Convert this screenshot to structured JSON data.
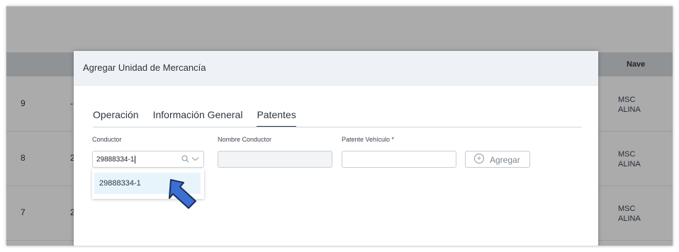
{
  "background_table": {
    "header": {
      "nave_label": "Nave"
    },
    "rows": [
      {
        "id_fragment": "9",
        "second_fragment": "-",
        "nave_line1": "MSC",
        "nave_line2": "ALINA"
      },
      {
        "id_fragment": "8",
        "second_fragment": "2",
        "nave_line1": "MSC",
        "nave_line2": "ALINA"
      },
      {
        "id_fragment": "7",
        "second_fragment": "2",
        "nave_line1": "MSC",
        "nave_line2": "ALINA"
      }
    ]
  },
  "modal": {
    "title": "Agregar Unidad de Mercancía",
    "tabs": [
      {
        "label": "Operación",
        "active": false
      },
      {
        "label": "Información General",
        "active": false
      },
      {
        "label": "Patentes",
        "active": true
      }
    ],
    "fields": {
      "conductor": {
        "label": "Conductor",
        "value": "29888334-1"
      },
      "nombre_conductor": {
        "label": "Nombre Conductor",
        "value": ""
      },
      "patente_vehiculo": {
        "label": "Patente Vehículo *",
        "value": ""
      }
    },
    "add_button": {
      "label": "Agregar"
    },
    "dropdown_options": [
      "29888334-1"
    ]
  },
  "colors": {
    "accent_dark": "#2b3a4a",
    "highlight": "#e8f4fb",
    "cursor_fill": "#3b6fd4"
  }
}
